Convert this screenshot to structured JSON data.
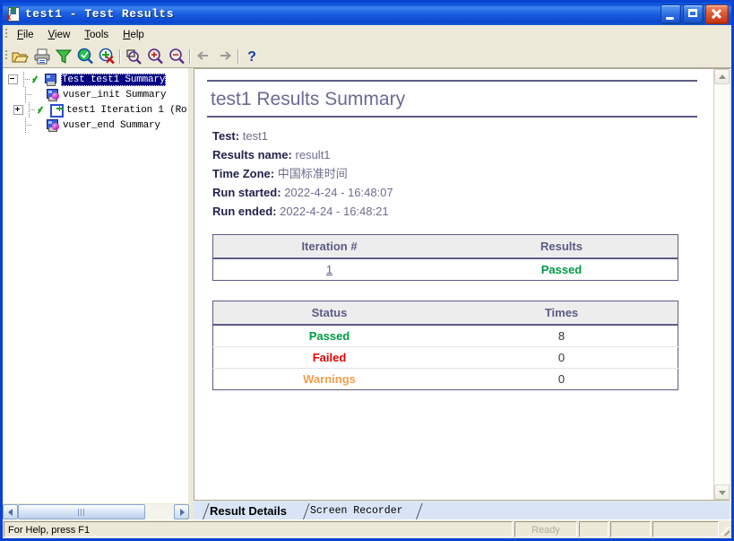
{
  "window": {
    "title": "test1 - Test Results",
    "icon": "test-results-icon",
    "buttons": {
      "minimize": "Minimize",
      "maximize": "Maximize",
      "close": "Close"
    }
  },
  "menu": {
    "items": [
      {
        "label": "File",
        "accel": "F"
      },
      {
        "label": "View",
        "accel": "V"
      },
      {
        "label": "Tools",
        "accel": "T"
      },
      {
        "label": "Help",
        "accel": "H"
      }
    ]
  },
  "toolbar": {
    "buttons": [
      {
        "name": "open-icon",
        "title": "Open"
      },
      {
        "name": "print-icon",
        "title": "Print"
      },
      {
        "name": "filter-icon",
        "title": "Filter"
      },
      {
        "name": "find-next-icon",
        "title": "Find Next"
      },
      {
        "name": "find-prev-icon",
        "title": "Find Previous"
      },
      {
        "name": "zoom-region-icon",
        "title": "Zoom Region"
      },
      {
        "name": "zoom-in-icon",
        "title": "Zoom In"
      },
      {
        "name": "zoom-out-icon",
        "title": "Zoom Out"
      },
      {
        "name": "back-arrow-icon",
        "title": "Back"
      },
      {
        "name": "forward-arrow-icon",
        "title": "Forward"
      },
      {
        "name": "help-icon",
        "title": "Help",
        "glyph": "?"
      }
    ]
  },
  "tree": {
    "nodes": [
      {
        "label": "Test test1 Summary",
        "icon": "monitor-icon",
        "check": true,
        "expander": "minus",
        "selected": true,
        "depth": 0
      },
      {
        "label": "vuser_init Summary",
        "icon": "vuser-icon",
        "check": false,
        "expander": "none",
        "selected": false,
        "depth": 1
      },
      {
        "label": "test1 Iteration 1 (Ro",
        "icon": "iteration-icon",
        "check": true,
        "expander": "plus",
        "selected": false,
        "depth": 1
      },
      {
        "label": "vuser_end Summary",
        "icon": "vuser-icon",
        "check": false,
        "expander": "none",
        "selected": false,
        "depth": 1
      }
    ]
  },
  "report": {
    "title": "test1 Results Summary",
    "meta": [
      {
        "label": "Test",
        "value": "test1"
      },
      {
        "label": "Results name",
        "value": "result1"
      },
      {
        "label": "Time Zone",
        "value": "中国标准时间"
      },
      {
        "label": "Run started",
        "value": "2022-4-24 - 16:48:07"
      },
      {
        "label": "Run ended",
        "value": "2022-4-24 - 16:48:21"
      }
    ],
    "iteration_table": {
      "headers": [
        "Iteration #",
        "Results"
      ],
      "rows": [
        {
          "iteration": "1",
          "result": "Passed",
          "result_status": "pass"
        }
      ]
    },
    "status_table": {
      "headers": [
        "Status",
        "Times"
      ],
      "rows": [
        {
          "status": "Passed",
          "times": "8",
          "kind": "pass"
        },
        {
          "status": "Failed",
          "times": "0",
          "kind": "fail"
        },
        {
          "status": "Warnings",
          "times": "0",
          "kind": "warn"
        }
      ]
    },
    "colors": {
      "title": "#6a6a96",
      "rule": "#5c5c87",
      "passed": "#009944",
      "failed": "#ee0000",
      "warnings": "#f2a04a"
    }
  },
  "tabs": [
    {
      "label": "Result Details",
      "active": true
    },
    {
      "label": "Screen Recorder",
      "active": false
    }
  ],
  "statusbar": {
    "hint": "For Help, press F1",
    "panes": [
      "Ready",
      "",
      "",
      ""
    ]
  }
}
